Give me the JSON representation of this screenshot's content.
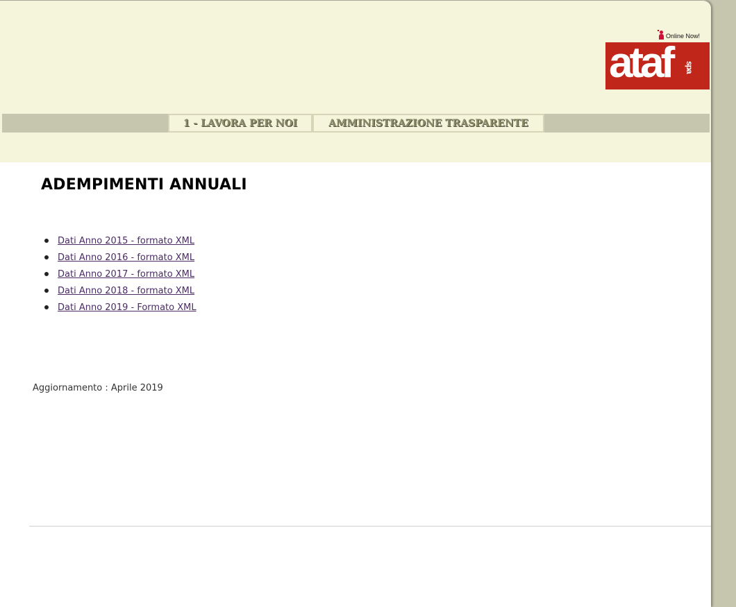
{
  "header": {
    "online_label": "Online Now!",
    "logo_main": "ataf",
    "logo_sub": "spa"
  },
  "nav": {
    "items": [
      {
        "label": "1 - LAVORA PER NOI"
      },
      {
        "label": "AMMINISTRAZIONE TRASPARENTE"
      }
    ]
  },
  "main": {
    "title": "ADEMPIMENTI ANNUALI",
    "links": [
      {
        "label": "Dati Anno 2015 - formato XML"
      },
      {
        "label": "Dati Anno 2016 - formato XML"
      },
      {
        "label": "Dati Anno 2017 - formato XML"
      },
      {
        "label": "Dati Anno 2018 - formato XML"
      },
      {
        "label": "Dati Anno 2019 - Formato XML"
      }
    ],
    "update": "Aggiornamento : Aprile 2019"
  },
  "colors": {
    "header_bg": "#f5f5dc",
    "nav_bar": "#c6c5ae",
    "logo_red": "#c0271a",
    "link": "#4b2a66"
  }
}
